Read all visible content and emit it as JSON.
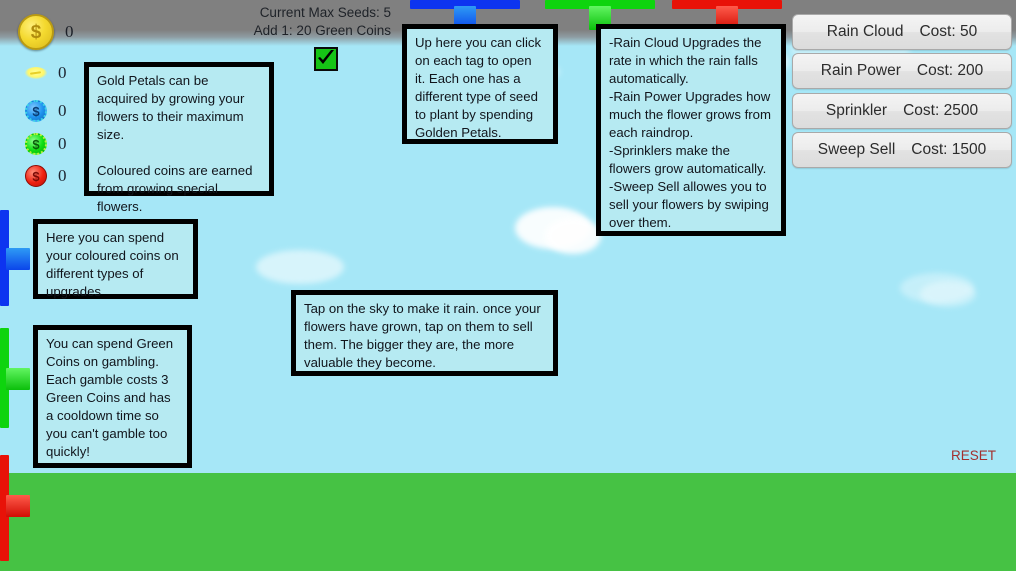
{
  "header": {
    "seed_line_1": "Current Max Seeds: 5",
    "seed_line_2": "Add 1: 20 Green Coins",
    "checkmark_icon": "check-icon"
  },
  "currencies": [
    {
      "id": "gold-petal",
      "icon": "gold-coin-icon",
      "value": "0"
    },
    {
      "id": "yellow-petal",
      "icon": "yellow-petal-icon",
      "value": "0"
    },
    {
      "id": "blue-coin",
      "icon": "blue-coin-icon",
      "value": "0"
    },
    {
      "id": "green-coin",
      "icon": "green-coin-icon",
      "value": "0"
    },
    {
      "id": "red-coin",
      "icon": "red-coin-icon",
      "value": "0"
    }
  ],
  "top_tabs": [
    {
      "id": "seed-tab-blue",
      "color": "#0d34f0"
    },
    {
      "id": "seed-tab-green",
      "color": "#0ed40e"
    },
    {
      "id": "seed-tab-red",
      "color": "#e81208"
    }
  ],
  "side_tabs": [
    {
      "id": "upgrade-tab-blue",
      "color": "#0d34f0"
    },
    {
      "id": "upgrade-tab-green",
      "color": "#0ed40e"
    },
    {
      "id": "upgrade-tab-red",
      "color": "#e81208"
    }
  ],
  "upgrades": [
    {
      "name": "Rain Cloud",
      "cost": "Cost: 50"
    },
    {
      "name": "Rain Power",
      "cost": "Cost: 200"
    },
    {
      "name": "Sprinkler",
      "cost": "Cost: 2500"
    },
    {
      "name": "Sweep Sell",
      "cost": "Cost: 1500"
    }
  ],
  "tips": {
    "petals": "Gold Petals can be acquired by growing your flowers to their maximum size.\n\nColoured coins are earned from growing special flowers.",
    "seed_tags": "Up here you can click on each tag to open it. Each one has a different type of seed to plant by spending Golden Petals.",
    "upgrade_list": "-Rain Cloud Upgrades the rate in which the rain falls automatically.\n-Rain Power Upgrades how much the flower grows from each raindrop.\n-Sprinklers make the flowers grow automatically.\n-Sweep Sell allowes you to sell your flowers by swiping over them.",
    "coin_upgrades": "Here you can spend your coloured coins on different types of upgrades",
    "gambling": "You can spend Green Coins on gambling. Each gamble costs 3 Green Coins and has a cooldown time so you can't gamble too quickly!",
    "sky_tap": "Tap on the sky to make it rain. once your flowers have grown, tap on them to sell them. The bigger they are, the more valuable they become."
  },
  "reset": {
    "label": "RESET"
  },
  "colors": {
    "sky": "#a6e7f7",
    "ground": "#46c244",
    "tooltip_bg": "#b6eaf2",
    "top_band": "#808080",
    "reset_text": "#a3302e"
  }
}
